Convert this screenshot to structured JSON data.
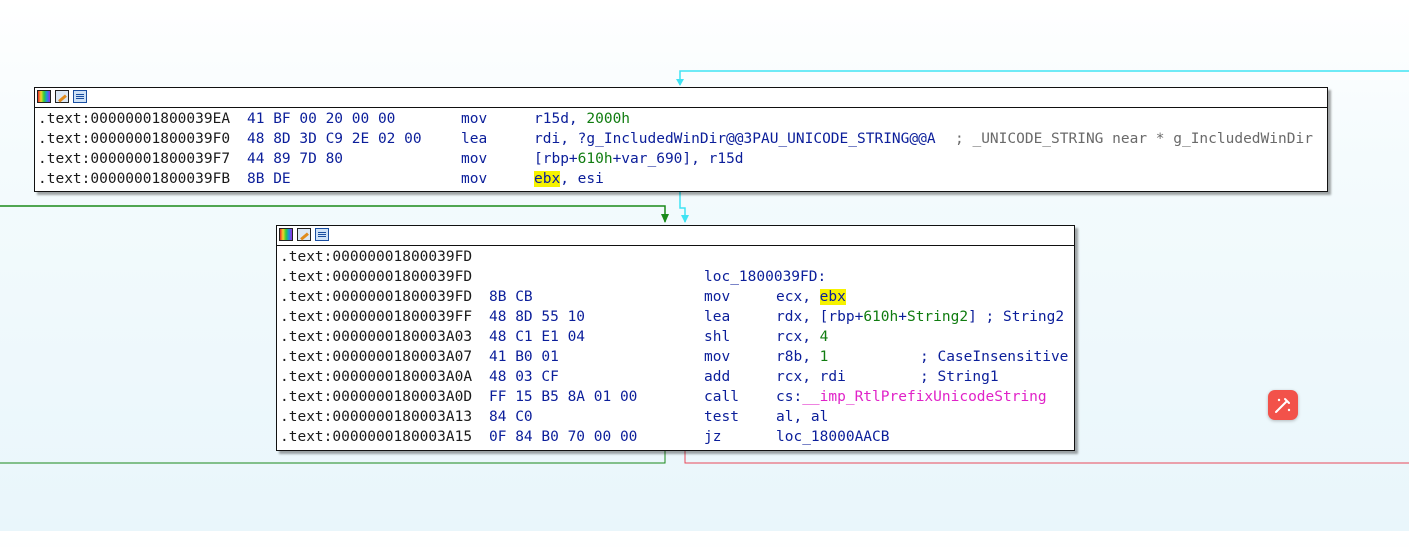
{
  "node1": {
    "lines": [
      {
        "addr": ".text:00000001800039EA",
        "bytes": "41 BF 00 20 00 00",
        "mnemonic": "mov",
        "op_a": "r15d, ",
        "op_num": "2000h"
      },
      {
        "addr": ".text:00000001800039F0",
        "bytes": "48 8D 3D C9 2E 02 00",
        "mnemonic": "lea",
        "op_a": "rdi, ?g_IncludedWinDir@@3PAU_UNICODE_STRING@@A",
        "comment": "; _UNICODE_STRING near * g_IncludedWinDir"
      },
      {
        "addr": ".text:00000001800039F7",
        "bytes": "44 89 7D 80",
        "mnemonic": "mov",
        "op_a": "[rbp+",
        "op_num": "610h",
        "op_b": "+var_690], r15d"
      },
      {
        "addr": ".text:00000001800039FB",
        "bytes": "8B DE",
        "mnemonic": "mov",
        "op_hl": "ebx",
        "op_a": ", esi"
      }
    ]
  },
  "node2": {
    "lines": [
      {
        "addr": ".text:00000001800039FD"
      },
      {
        "addr": ".text:00000001800039FD",
        "label": "loc_1800039FD:"
      },
      {
        "addr": ".text:00000001800039FD",
        "bytes": "8B CB",
        "mnemonic": "mov",
        "op_a": "ecx, ",
        "op_hl": "ebx"
      },
      {
        "addr": ".text:00000001800039FF",
        "bytes": "48 8D 55 10",
        "mnemonic": "lea",
        "op_a": "rdx, [rbp+",
        "op_num": "610h",
        "op_b": "+",
        "op_num2": "String2",
        "op_c": "] ; String2"
      },
      {
        "addr": ".text:0000000180003A03",
        "bytes": "48 C1 E1 04",
        "mnemonic": "shl",
        "op_a": "rcx, ",
        "op_num": "4"
      },
      {
        "addr": ".text:0000000180003A07",
        "bytes": "41 B0 01",
        "mnemonic": "mov",
        "op_a": "r8b, ",
        "op_num": "1",
        "comment": "; CaseInsensitive"
      },
      {
        "addr": ".text:0000000180003A0A",
        "bytes": "48 03 CF",
        "mnemonic": "add",
        "op_a": "rcx, rdi",
        "comment": "; String1"
      },
      {
        "addr": ".text:0000000180003A0D",
        "bytes": "FF 15 B5 8A 01 00",
        "mnemonic": "call",
        "op_a": "cs:",
        "op_imp": "__imp_RtlPrefixUnicodeString"
      },
      {
        "addr": ".text:0000000180003A13",
        "bytes": "84 C0",
        "mnemonic": "test",
        "op_a": "al, al"
      },
      {
        "addr": ".text:0000000180003A15",
        "bytes": "0F 84 B0 70 00 00",
        "mnemonic": "jz",
        "op_a": "loc_18000AACB"
      }
    ]
  },
  "icons": [
    "color-picker-icon",
    "edit-node-icon",
    "graph-view-icon",
    "magic-edit-icon"
  ],
  "colors": {
    "edge_cyan": "#3fe3f3",
    "edge_green": "#1a8a1a",
    "edge_red": "#e84a5a",
    "highlight": "#f6f200"
  }
}
